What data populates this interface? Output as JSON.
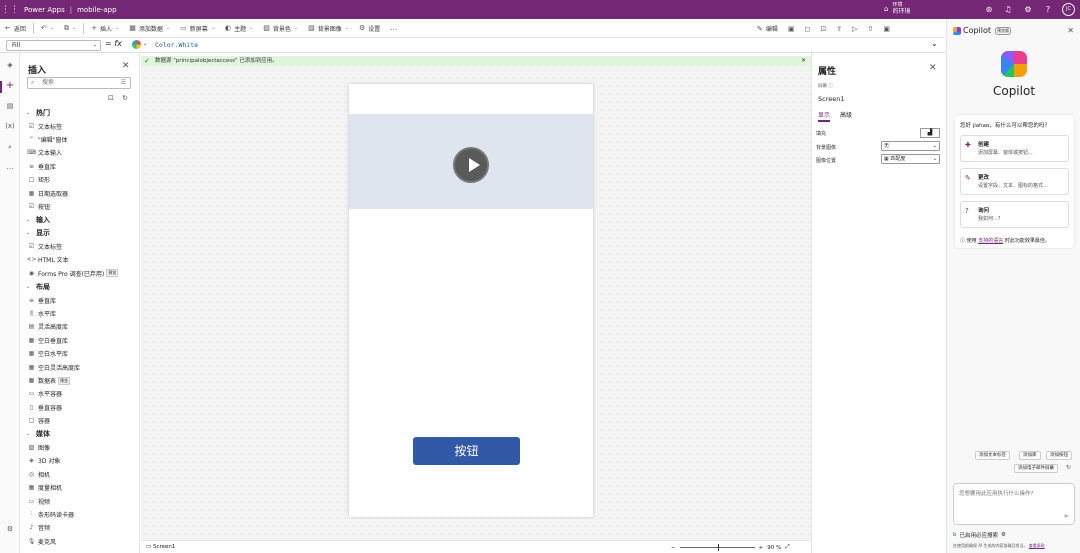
{
  "topbar": {
    "app_name": "Power Apps",
    "project": "mobile-app",
    "env_label": "环境",
    "env_name": "的环境",
    "avatar": "JC"
  },
  "commands": [
    {
      "icon": "←",
      "label": "返回",
      "dd": false,
      "iconname": "back-icon"
    },
    {
      "icon": "↶",
      "label": "",
      "dd": true,
      "iconname": "undo-icon"
    },
    {
      "icon": "⧉",
      "label": "",
      "dd": true,
      "iconname": "copy-icon"
    },
    {
      "icon": "+",
      "label": "插入",
      "dd": true,
      "iconname": "plus-icon"
    },
    {
      "icon": "▦",
      "label": "添加数据",
      "dd": true,
      "iconname": "database-icon"
    },
    {
      "icon": "▭",
      "label": "新屏幕",
      "dd": true,
      "iconname": "screen-icon"
    },
    {
      "icon": "◐",
      "label": "主题",
      "dd": true,
      "iconname": "theme-icon"
    },
    {
      "icon": "▨",
      "label": "背景色",
      "dd": true,
      "iconname": "paint-icon"
    },
    {
      "icon": "▧",
      "label": "背景图像",
      "dd": true,
      "iconname": "image-icon"
    },
    {
      "icon": "⚙",
      "label": "设置",
      "dd": false,
      "iconname": "settings-icon"
    },
    {
      "icon": "…",
      "label": "",
      "dd": false,
      "iconname": "more-icon"
    }
  ],
  "right_commands": [
    {
      "icon": "✎",
      "label": "编辑",
      "iconname": "edit-icon"
    },
    {
      "icon": "▣",
      "label": "",
      "iconname": "copilot-toggle-icon"
    },
    {
      "icon": "◻",
      "label": "",
      "iconname": "comment-icon"
    },
    {
      "icon": "⊡",
      "label": "",
      "iconname": "checker-icon"
    },
    {
      "icon": "⇪",
      "label": "",
      "iconname": "share-icon"
    },
    {
      "icon": "▷",
      "label": "",
      "iconname": "play-icon"
    },
    {
      "icon": "⇧",
      "label": "",
      "iconname": "publish-icon"
    },
    {
      "icon": "▣",
      "label": "",
      "iconname": "save-icon"
    }
  ],
  "formula": {
    "property": "Fill",
    "expression": "Color.White",
    "fx": "= fx"
  },
  "notice": {
    "text": "数据源 \"principalobjectaccess\" 已添加到应用。"
  },
  "insert": {
    "title": "插入",
    "search_placeholder": "搜索",
    "rows": [
      {
        "t": "cat",
        "label": "热门"
      },
      {
        "t": "item",
        "icon": "☑",
        "label": "文本标签"
      },
      {
        "t": "item",
        "icon": "\"",
        "label": "\"编辑\"窗体"
      },
      {
        "t": "item",
        "icon": "⌨",
        "label": "文本输入"
      },
      {
        "t": "item",
        "icon": "≡",
        "label": "垂直库"
      },
      {
        "t": "item",
        "icon": "□",
        "label": "矩形"
      },
      {
        "t": "item",
        "icon": "▦",
        "label": "日期选取器"
      },
      {
        "t": "item",
        "icon": "☑",
        "label": "按钮"
      },
      {
        "t": "cat",
        "label": "输入"
      },
      {
        "t": "cat",
        "label": "显示"
      },
      {
        "t": "item",
        "icon": "☑",
        "label": "文本标签"
      },
      {
        "t": "item",
        "icon": "<>",
        "label": "HTML 文本"
      },
      {
        "t": "item",
        "icon": "◉",
        "label": "Forms Pro 调查(已弃用)",
        "badge": "预览"
      },
      {
        "t": "cat",
        "label": "布局"
      },
      {
        "t": "item",
        "icon": "≡",
        "label": "垂直库"
      },
      {
        "t": "item",
        "icon": "⫼",
        "label": "水平库"
      },
      {
        "t": "item",
        "icon": "▤",
        "label": "灵活高度库"
      },
      {
        "t": "item",
        "icon": "▦",
        "label": "空白垂直库"
      },
      {
        "t": "item",
        "icon": "▦",
        "label": "空白水平库"
      },
      {
        "t": "item",
        "icon": "▦",
        "label": "空白灵活高度库"
      },
      {
        "t": "item",
        "icon": "▦",
        "label": "数据表",
        "badge": "预览"
      },
      {
        "t": "item",
        "icon": "▭",
        "label": "水平容器"
      },
      {
        "t": "item",
        "icon": "▯",
        "label": "垂直容器"
      },
      {
        "t": "item",
        "icon": "□",
        "label": "容器"
      },
      {
        "t": "cat",
        "label": "媒体"
      },
      {
        "t": "item",
        "icon": "▨",
        "label": "图像"
      },
      {
        "t": "item",
        "icon": "◈",
        "label": "3D 对象"
      },
      {
        "t": "item",
        "icon": "◎",
        "label": "相机"
      },
      {
        "t": "item",
        "icon": "▦",
        "label": "度量相机"
      },
      {
        "t": "item",
        "icon": "▭",
        "label": "视频"
      },
      {
        "t": "item",
        "icon": "⫶",
        "label": "条形码读卡器"
      },
      {
        "t": "item",
        "icon": "♪",
        "label": "音频"
      },
      {
        "t": "item",
        "icon": "🎙",
        "label": "麦克风"
      }
    ]
  },
  "canvas": {
    "button_label": "按钮"
  },
  "status": {
    "screen": "Screen1",
    "zoom_minus": "−",
    "zoom_plus": "+",
    "zoom": "90 %"
  },
  "properties": {
    "title": "属性",
    "type_label": "屏幕",
    "name": "Screen1",
    "tabs": [
      "显示",
      "高级"
    ],
    "rows": [
      {
        "label": "填充",
        "value": ""
      },
      {
        "label": "背景图像",
        "value": "无"
      },
      {
        "label": "图像位置",
        "value": "匹配度"
      }
    ]
  },
  "copilot": {
    "header": "Copilot",
    "tag": "预览版",
    "title": "Copilot",
    "greeting": "您好 jiahao，有什么可以帮您的吗？",
    "suggestions": [
      {
        "icon": "✚",
        "title": "创建",
        "desc": "添加屏幕、窗体或按钮..."
      },
      {
        "icon": "✎",
        "title": "更改",
        "desc": "设置字段、文本、图标的格式..."
      },
      {
        "icon": "?",
        "title": "询问",
        "desc": "我如何...?"
      }
    ],
    "info_pre": "使用",
    "info_link": "支持的语言",
    "info_post": "时此功能效果最佳。",
    "chips": [
      "添加文本标签",
      "添加库",
      "添加按钮",
      "添加电子邮件屏幕"
    ],
    "input_placeholder": "您想要用此应用执行什么操作?",
    "footer": "已启用必应搜索",
    "disclaimer_pre": "在使用前确保 AI 生成的内容准确且恰当。",
    "disclaimer_link": "查看条款"
  }
}
